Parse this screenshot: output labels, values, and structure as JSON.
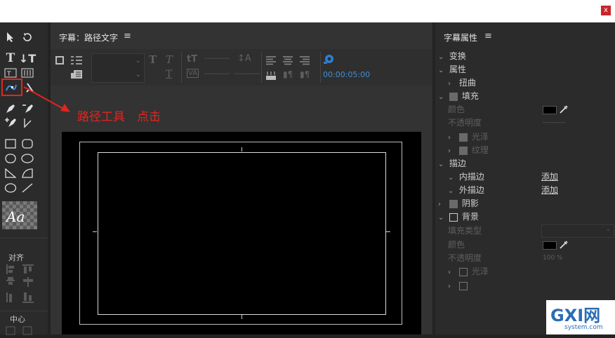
{
  "window": {
    "close_label": "x"
  },
  "toolbox": {
    "align_label": "对齐",
    "center_label": "中心",
    "style_preview_text": "Aa"
  },
  "canvas": {
    "panel_title": "字幕：路径文字",
    "timecode": "00:00:05:00",
    "annotation": "路径工具　点击",
    "accent": "#e0261f"
  },
  "props": {
    "panel_title": "字幕属性",
    "transform": "变换",
    "attributes": "属性",
    "distort": "扭曲",
    "fill": "填充",
    "color": "颜色",
    "opacity": "不透明度",
    "sheen": "光泽",
    "texture": "纹理",
    "stroke": "描边",
    "inner_stroke": "内描边",
    "outer_stroke": "外描边",
    "add": "添加",
    "shadow": "阴影",
    "background": "背景",
    "fill_type": "填充类型",
    "opacity_value": "100 %",
    "dash": "----------"
  },
  "watermark": {
    "brand": "GXI网",
    "domain": "system.com"
  }
}
